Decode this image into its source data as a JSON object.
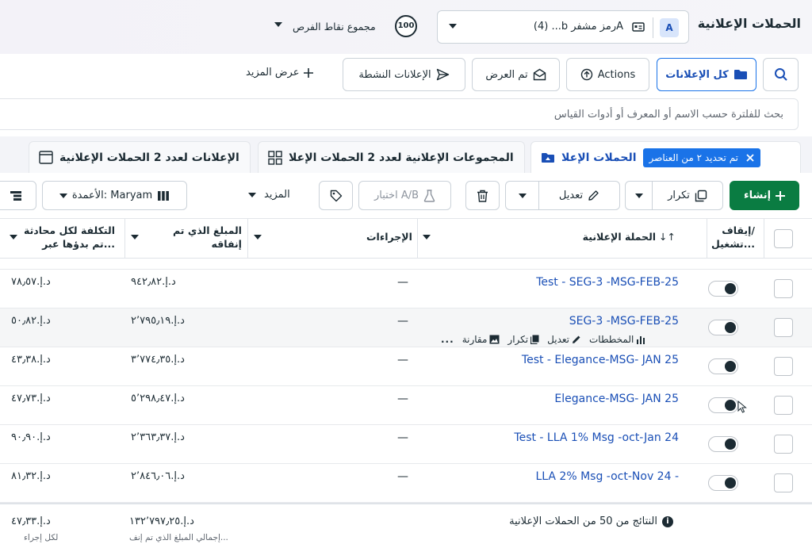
{
  "header": {
    "title": "الحملات الإعلانية",
    "account_badge": "A",
    "account_name": "(4) ...b ‫Aرمز مشفر‬",
    "opportunity_score": "100",
    "opportunity_label": "مجموع نقاط الفرص"
  },
  "filters": {
    "all_ads": "كل الإعلانات",
    "actions": "Actions",
    "viewed": "تم العرض",
    "active_ads": "الإعلانات النشطة",
    "view_more": "عرض المزيد",
    "search_placeholder": "بحث للفلترة حسب الاسم أو المعرف أو أدوات القياس"
  },
  "tabs": {
    "campaigns": "الحملات الإعلا",
    "selected_chip": "تم تحديد ٢ من العناصر",
    "adsets": "المجموعات الإعلانية لعدد 2 الحملات الإعلا",
    "ads": "الإعلانات لعدد 2 الحملات الإعلانية"
  },
  "toolbar": {
    "create": "إنشاء",
    "duplicate": "تكرار",
    "edit": "تعديل",
    "ab_test": "اختبار A/B",
    "more": "المزيد",
    "columns": "الأعمدة: Maryam"
  },
  "table": {
    "headers": {
      "toggle": "إيقاف/\nتشغيل...",
      "campaign": "الحملة الإعلانية",
      "actions": "الإجراءات",
      "spent": "المبلغ الذي تم\nإنفاقه",
      "cpc": "التكلفة لكل محادثة\nتم بدؤها عبر..."
    },
    "rows": [
      {
        "name": "Test - SEG-3 -MSG-FEB-25",
        "actions": "—",
        "spent": "د.إ.‏٩٤٢٫٨٢",
        "cpc": "د.إ.‏٧٨٫٥٧"
      },
      {
        "name": "SEG-3 -MSG-FEB-25",
        "actions": "—",
        "spent": "د.إ.‏٢٬٧٩٥٫١٩",
        "cpc": "د.إ.‏٥٠٫٨٢"
      },
      {
        "name": "Test - Elegance-MSG- JAN 25",
        "actions": "—",
        "spent": "د.إ.‏٣٬٧٧٤٫٣٥",
        "cpc": "د.إ.‏٤٣٫٣٨"
      },
      {
        "name": "Elegance-MSG- JAN 25",
        "actions": "—",
        "spent": "د.إ.‏٥٬٢٩٨٫٤٧",
        "cpc": "د.إ.‏٤٧٫٧٣"
      },
      {
        "name": "Test - LLA 1% Msg -oct-Jan 24",
        "actions": "—",
        "spent": "د.إ.‏٢٬٣٦٣٫٣٧",
        "cpc": "د.إ.‏٩٠٫٩٠"
      },
      {
        "name": "LLA 2% Msg -oct-Nov 24 -",
        "actions": "—",
        "spent": "د.إ.‏٢٬٨٤٦٫٠٦",
        "cpc": "د.إ.‏٨١٫٣٢"
      }
    ],
    "row_actions": {
      "charts": "المخططات",
      "edit": "تعديل",
      "duplicate": "تكرار",
      "compare": "مقارنة",
      "more": "..."
    },
    "footer": {
      "results": "النتائج من 50 من الحملات الإعلانية",
      "total_spent": "د.إ.‏١٣٢٬٧٩٧٫٢٥",
      "total_spent_label": "إجمالي المبلغ الذي تم إنف...",
      "total_cpc": "د.إ.‏٤٧٫٣٣",
      "total_cpc_label": "لكل إجراء"
    }
  }
}
